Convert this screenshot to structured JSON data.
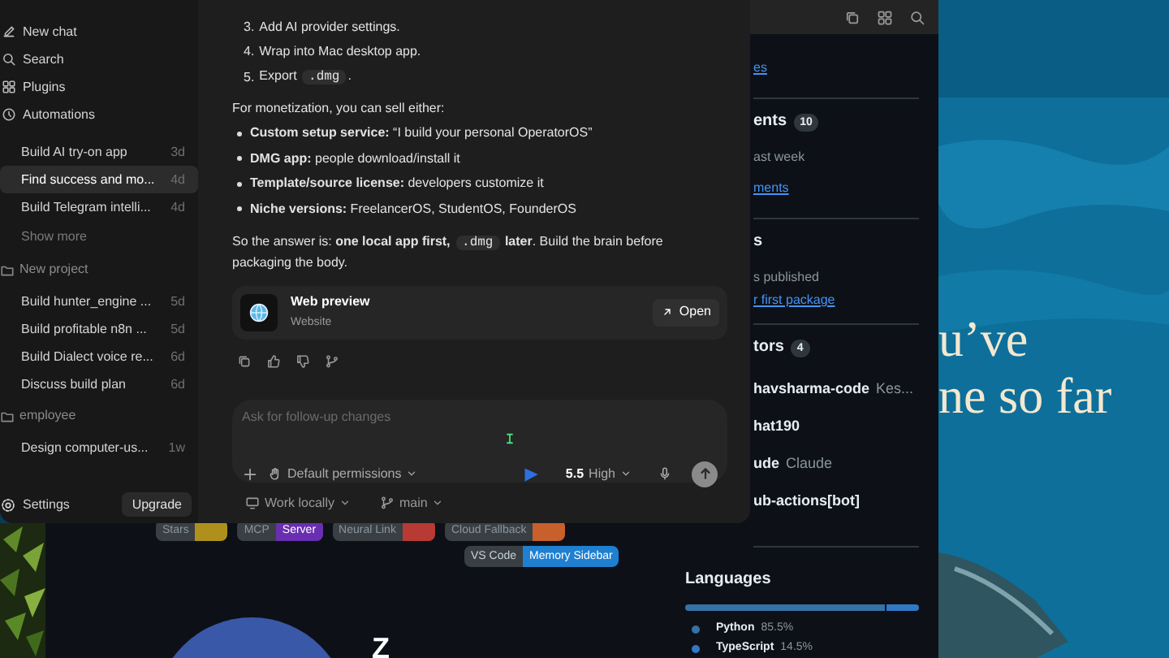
{
  "desktop": {
    "overlay_lines": [
      "u’ve",
      "ne so far"
    ]
  },
  "browser": {
    "sidebar": [
      {
        "kind": "link",
        "text": "es"
      },
      {
        "kind": "heading",
        "text": "ents",
        "count": "10"
      },
      {
        "kind": "text",
        "text": "ast week"
      },
      {
        "kind": "link",
        "text": "ments"
      },
      {
        "kind": "heading",
        "text": "s"
      },
      {
        "kind": "text",
        "text": "s published"
      },
      {
        "kind": "link",
        "text": "r first package"
      },
      {
        "kind": "heading",
        "text": "tors",
        "count": "4"
      },
      {
        "kind": "contributor",
        "text": "havsharma-code",
        "note": "Kes..."
      },
      {
        "kind": "contributor",
        "text": "hat190"
      },
      {
        "kind": "contributor",
        "text": "ude",
        "note": "Claude"
      },
      {
        "kind": "contributor",
        "text": "ub-actions[bot]"
      }
    ],
    "languages": {
      "title": "Languages",
      "items": [
        {
          "name": "Python",
          "percent": "85.5%",
          "level": 0.855,
          "color": "#3572a5"
        },
        {
          "name": "TypeScript",
          "percent": "14.5%",
          "color": "#3178c6"
        }
      ]
    },
    "badges": [
      {
        "label": "Stars",
        "color": "#b0901c"
      },
      {
        "label": "MCP",
        "value": "Server",
        "color": "#6a2fb0"
      },
      {
        "label": "Neural Link",
        "color": "#b83a34"
      },
      {
        "label": "Cloud Fallback",
        "color": "#c8602c"
      },
      {
        "label": "VS Code",
        "value": "Memory Sidebar",
        "color": "#1f7fd0"
      }
    ],
    "heading_letter": "Z"
  },
  "chat_app": {
    "nav": [
      {
        "label": "New chat",
        "kind": "compose"
      },
      {
        "label": "Search",
        "kind": "search"
      },
      {
        "label": "Plugins",
        "kind": "plugins"
      },
      {
        "label": "Automations",
        "kind": "clock"
      }
    ],
    "threads": [
      {
        "title": "Build AI try-on app",
        "age": "3d",
        "selected": false
      },
      {
        "title": "Find success and mo...",
        "age": "4d",
        "selected": true
      },
      {
        "title": "Build Telegram intelli...",
        "age": "4d",
        "selected": false
      }
    ],
    "show_more": "Show more",
    "projects": [
      {
        "name": "New project",
        "threads": [
          {
            "title": "Build hunter_engine ...",
            "age": "5d",
            "selected": false
          },
          {
            "title": "Build profitable n8n ...",
            "age": "5d",
            "selected": false
          },
          {
            "title": "Build Dialect voice re...",
            "age": "6d",
            "selected": false
          },
          {
            "title": "Discuss build plan",
            "age": "6d",
            "selected": false
          }
        ]
      },
      {
        "name": "employee",
        "threads": [
          {
            "title": "Design computer-us...",
            "age": "1w",
            "selected": false
          }
        ]
      }
    ],
    "settings": "Settings",
    "upgrade": "Upgrade",
    "message": {
      "steps": [
        {
          "number": "3.",
          "parts": [
            {
              "kind": "text",
              "text": "Add AI provider settings."
            }
          ]
        },
        {
          "number": "4.",
          "parts": [
            {
              "kind": "text",
              "text": "Wrap into Mac desktop app."
            }
          ]
        },
        {
          "number": "5.",
          "parts": [
            {
              "kind": "text",
              "text": "Export "
            },
            {
              "kind": "code",
              "text": ".dmg"
            },
            {
              "kind": "text",
              "text": "."
            }
          ]
        }
      ],
      "intro": "For monetization, you can sell either:",
      "bullets": [
        "**Custom setup service:** “I build your personal OperatorOS”",
        "**DMG app:** people download/install it",
        "**Template/source license:** developers customize it",
        "**Niche versions:** FreelancerOS, StudentOS, FounderOS"
      ],
      "conclusion": [
        {
          "kind": "text",
          "text": "So the answer is: **one local app first,** "
        },
        {
          "kind": "code",
          "text": ".dmg"
        },
        {
          "kind": "text",
          "text": " **later**. Build the brain before packaging the body."
        }
      ]
    },
    "preview_card": {
      "title": "Web preview",
      "subtitle": "Website",
      "action": "Open"
    },
    "composer": {
      "placeholder": "Ask for follow-up changes",
      "permissions": "Default permissions",
      "model": "5.5",
      "effort": "High"
    },
    "footer": {
      "location": "Work locally",
      "branch": "main"
    }
  }
}
